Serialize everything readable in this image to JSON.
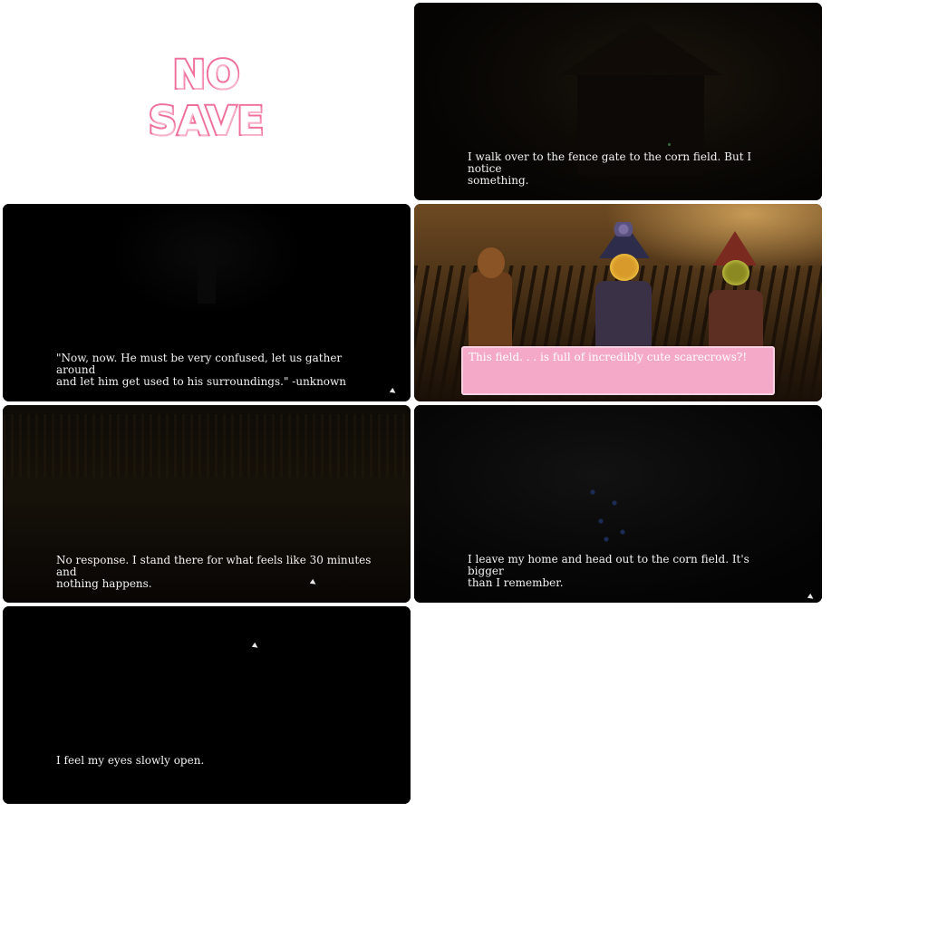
{
  "badge": {
    "line1": "NO",
    "line2": "SAVE"
  },
  "panels": {
    "gate": {
      "text": "I walk over to the fence gate to the corn field. But I notice\nsomething."
    },
    "confused": {
      "text": "\"Now, now. He must be very confused, let us gather around\nand let him get used to his surroundings.\" -unknown"
    },
    "scarecrows": {
      "text": "This field. . . is full of incredibly cute scarecrows?!"
    },
    "noresponse": {
      "text": "No response. I stand there for what feels like 30 minutes and\nnothing happens."
    },
    "leave": {
      "text": "I leave my home and head out to the corn field. It's bigger\nthan I remember."
    },
    "eyes": {
      "text": "I feel my eyes slowly open."
    }
  },
  "colors": {
    "badge_outline": "#f06f9a",
    "dialog_box": "#f4a9c8",
    "text": "#f2f2f2"
  },
  "icons": {
    "advance": "advance-arrow-icon"
  }
}
